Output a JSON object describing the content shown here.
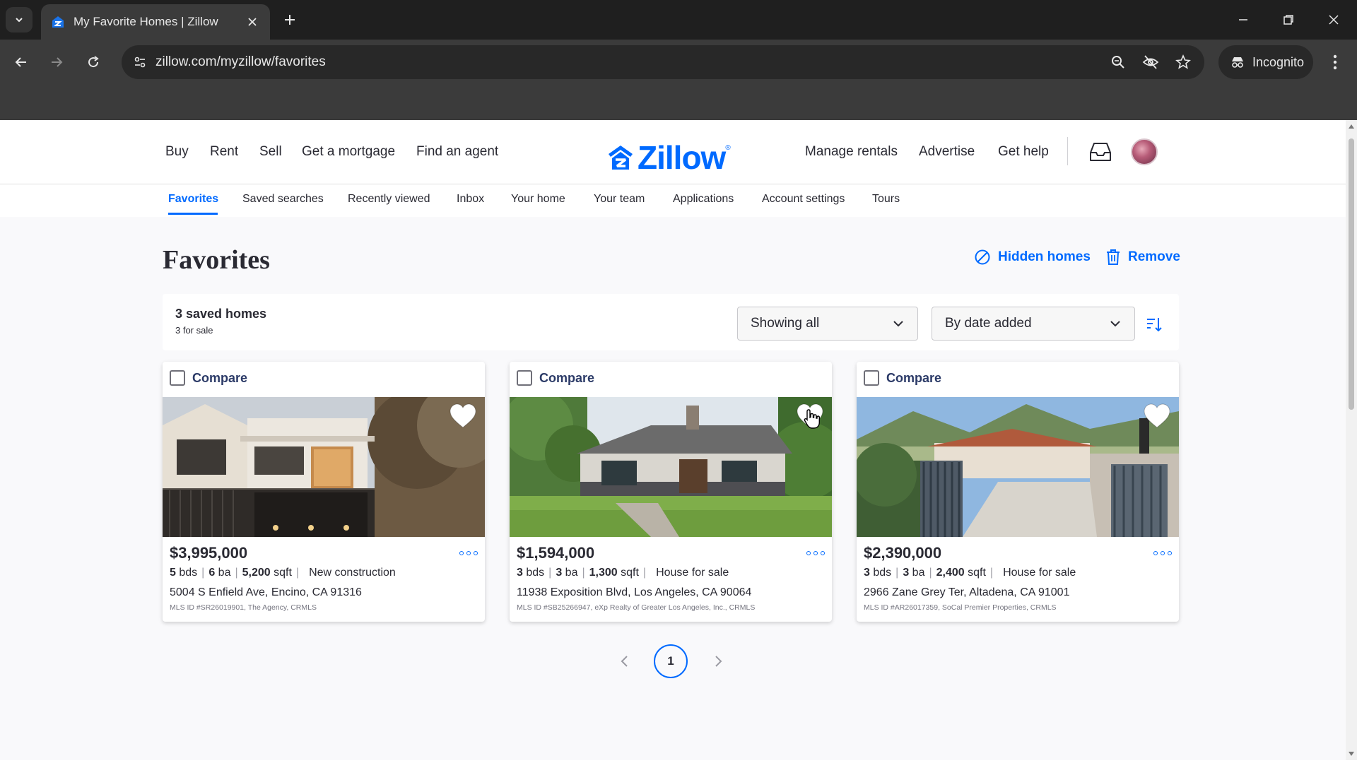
{
  "browser": {
    "tab_title": "My Favorite Homes | Zillow",
    "url": "zillow.com/myzillow/favorites",
    "incognito_label": "Incognito"
  },
  "header": {
    "nav_left": [
      "Buy",
      "Rent",
      "Sell",
      "Get a mortgage",
      "Find an agent"
    ],
    "logo_text": "Zillow",
    "nav_right": [
      "Manage rentals",
      "Advertise",
      "Get help"
    ]
  },
  "subnav": {
    "items": [
      "Favorites",
      "Saved searches",
      "Recently viewed",
      "Inbox",
      "Your home",
      "Your team",
      "Applications",
      "Account settings",
      "Tours"
    ],
    "active": "Favorites"
  },
  "page": {
    "title": "Favorites",
    "hidden_homes_label": "Hidden homes",
    "remove_label": "Remove"
  },
  "summary": {
    "count_label": "3 saved homes",
    "sub_label": "3 for sale",
    "filter_value": "Showing all",
    "sort_value": "By date added"
  },
  "cards": [
    {
      "compare_label": "Compare",
      "price": "$3,995,000",
      "beds": "5",
      "beds_unit": "bds",
      "baths": "6",
      "baths_unit": "ba",
      "sqft": "5,200",
      "sqft_unit": "sqft",
      "type": "New construction",
      "address": "5004 S Enfield Ave, Encino, CA 91316",
      "mls": "MLS ID #SR26019901, The Agency, CRMLS"
    },
    {
      "compare_label": "Compare",
      "price": "$1,594,000",
      "beds": "3",
      "beds_unit": "bds",
      "baths": "3",
      "baths_unit": "ba",
      "sqft": "1,300",
      "sqft_unit": "sqft",
      "type": "House for sale",
      "address": "11938 Exposition Blvd, Los Angeles, CA 90064",
      "mls": "MLS ID #SB25266947, eXp Realty of Greater Los Angeles, Inc., CRMLS"
    },
    {
      "compare_label": "Compare",
      "price": "$2,390,000",
      "beds": "3",
      "beds_unit": "bds",
      "baths": "3",
      "baths_unit": "ba",
      "sqft": "2,400",
      "sqft_unit": "sqft",
      "type": "House for sale",
      "address": "2966 Zane Grey Ter, Altadena, CA 91001",
      "mls": "MLS ID #AR26017359, SoCal Premier Properties, CRMLS"
    }
  ],
  "pagination": {
    "current": "1"
  },
  "colors": {
    "brand": "#006aff",
    "text": "#2a2a33",
    "compare": "#2b3a67"
  }
}
